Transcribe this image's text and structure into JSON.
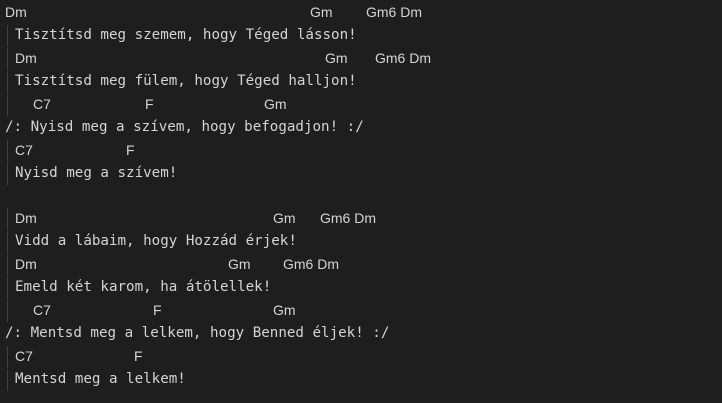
{
  "theme": {
    "background": "#1e1e1e",
    "text": "#d4d4d4",
    "indent_guide": "#404040"
  },
  "song": {
    "verse1": {
      "c1": [
        "Dm",
        "Gm",
        "Gm6 Dm"
      ],
      "l1": "Tisztítsd meg szemem, hogy Téged lásson!",
      "c2": [
        "Dm",
        "Gm",
        "Gm6 Dm"
      ],
      "l2": "Tisztítsd meg fülem, hogy Téged halljon!",
      "c3": [
        "C7",
        "F",
        "Gm"
      ],
      "l3": "/: Nyisd meg a szívem, hogy befogadjon! :/",
      "c4": [
        "C7",
        "F"
      ],
      "l4": "Nyisd meg a szívem!"
    },
    "verse2": {
      "c1": [
        "Dm",
        "Gm",
        "Gm6 Dm"
      ],
      "l1": "Vidd a lábaim, hogy Hozzád érjek!",
      "c2": [
        "Dm",
        "Gm",
        "Gm6 Dm"
      ],
      "l2": "Emeld két karom, ha átölellek!",
      "c3": [
        "C7",
        "F",
        "Gm"
      ],
      "l3": "/: Mentsd meg a lelkem, hogy Benned éljek! :/",
      "c4": [
        "C7",
        "F"
      ],
      "l4": "Mentsd meg a lelkem!"
    }
  }
}
